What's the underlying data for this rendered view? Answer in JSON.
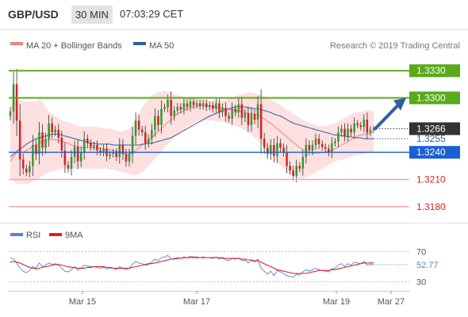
{
  "header": {
    "symbol": "GBP/USD",
    "timeframe": "30 MIN",
    "time": "07:03:29 CET"
  },
  "legend": {
    "ma20_label": "MA 20 + Bollinger Bands",
    "ma50_label": "MA 50",
    "credit": "Research © 2019 Trading Central",
    "ma20_color": "#f08080",
    "ma50_color": "#2e5fa3"
  },
  "rsi_legend": {
    "rsi_label": "RSI",
    "ma9_label": "9MA",
    "rsi_color": "#5b7fd6",
    "ma9_color": "#e02020"
  },
  "colors": {
    "resistance": "#5aaa1c",
    "support": "#1a5fd6",
    "target": "#f4a6a6",
    "current": "#333333",
    "arrow": "#2e5fa3",
    "candle_up": "#2e9a2e",
    "candle_down": "#d62020",
    "band_fill": "#fde0e0"
  },
  "chart_data": [
    {
      "type": "candlestick",
      "title": "GBP/USD",
      "timeframe": "30 MIN",
      "x_ticks": [
        "Mar 15",
        "Mar 17",
        "Mar 19",
        "Mar 27"
      ],
      "ylim": [
        1.3165,
        1.3345
      ],
      "levels": [
        {
          "label": "1.3330",
          "value": 1.333,
          "kind": "resistance"
        },
        {
          "label": "1.3300",
          "value": 1.33,
          "kind": "resistance"
        },
        {
          "label": "1.3266",
          "value": 1.3266,
          "kind": "current"
        },
        {
          "label": "1.3255",
          "value": 1.3255,
          "kind": "ma"
        },
        {
          "label": "1.3240",
          "value": 1.324,
          "kind": "support"
        },
        {
          "label": "1.3210",
          "value": 1.321,
          "kind": "target"
        },
        {
          "label": "1.3180",
          "value": 1.318,
          "kind": "target"
        }
      ],
      "close": [
        1.3285,
        1.3315,
        1.3275,
        1.3232,
        1.3222,
        1.3218,
        1.3225,
        1.3248,
        1.3238,
        1.3262,
        1.3245,
        1.3255,
        1.3272,
        1.3262,
        1.3265,
        1.3256,
        1.3242,
        1.3226,
        1.3222,
        1.3235,
        1.3246,
        1.323,
        1.324,
        1.3255,
        1.325,
        1.3246,
        1.3248,
        1.3242,
        1.324,
        1.3244,
        1.3236,
        1.3238,
        1.324,
        1.3235,
        1.3248,
        1.3238,
        1.323,
        1.3238,
        1.3258,
        1.3275,
        1.3265,
        1.3262,
        1.325,
        1.3255,
        1.3265,
        1.328,
        1.327,
        1.3288,
        1.329,
        1.3298,
        1.328,
        1.3286,
        1.329,
        1.3287,
        1.3294,
        1.329,
        1.3296,
        1.3292,
        1.3294,
        1.3291,
        1.3294,
        1.329,
        1.3292,
        1.3288,
        1.3294,
        1.3284,
        1.3289,
        1.328,
        1.3277,
        1.3288,
        1.3284,
        1.3293,
        1.3278,
        1.3283,
        1.327,
        1.3282,
        1.3276,
        1.3293,
        1.3255,
        1.3245,
        1.3238,
        1.3248,
        1.3236,
        1.325,
        1.3245,
        1.324,
        1.3225,
        1.322,
        1.3214,
        1.3225,
        1.3222,
        1.3235,
        1.3248,
        1.3242,
        1.3248,
        1.3255,
        1.3249,
        1.3246,
        1.3244,
        1.324,
        1.325,
        1.3252,
        1.3262,
        1.3266,
        1.3258,
        1.3266,
        1.3262,
        1.3272,
        1.327,
        1.3268,
        1.3276,
        1.3262,
        1.3265,
        1.3266
      ],
      "ma20": [
        1.323,
        1.3235,
        1.324,
        1.324,
        1.324,
        1.3242,
        1.3244,
        1.3247,
        1.3248,
        1.325,
        1.3252,
        1.3253,
        1.3254,
        1.3254,
        1.3254,
        1.3253,
        1.3252,
        1.3251,
        1.325,
        1.3248,
        1.3247,
        1.3246,
        1.3245,
        1.3245,
        1.3245,
        1.3245,
        1.3245,
        1.3245,
        1.3244,
        1.3244,
        1.3243,
        1.3243,
        1.3242,
        1.3241,
        1.324,
        1.3239,
        1.3238,
        1.3238,
        1.324,
        1.3242,
        1.3245,
        1.3248,
        1.325,
        1.3253,
        1.3256,
        1.326,
        1.3263,
        1.3266,
        1.327,
        1.3273,
        1.3276,
        1.3279,
        1.3282,
        1.3284,
        1.3286,
        1.3288,
        1.3289,
        1.329,
        1.3291,
        1.3291,
        1.3291,
        1.3291,
        1.3291,
        1.329,
        1.329,
        1.3289,
        1.3289,
        1.3288,
        1.3287,
        1.3287,
        1.3286,
        1.3286,
        1.3285,
        1.3284,
        1.3283,
        1.3283,
        1.3282,
        1.3281,
        1.3279,
        1.3277,
        1.3274,
        1.3272,
        1.3269,
        1.3266,
        1.3263,
        1.326,
        1.3257,
        1.3254,
        1.3251,
        1.3248,
        1.3245,
        1.3243,
        1.3241,
        1.324,
        1.3239,
        1.3239,
        1.3239,
        1.324,
        1.324,
        1.3241,
        1.3242,
        1.3244,
        1.3246,
        1.3248,
        1.325,
        1.3252,
        1.3254,
        1.3256,
        1.3258,
        1.3259,
        1.326,
        1.3261,
        1.3261,
        1.3262
      ],
      "bb_upper": [
        1.329,
        1.3298,
        1.33,
        1.3298,
        1.3296,
        1.3296,
        1.3296,
        1.3296,
        1.3296,
        1.3298,
        1.3296,
        1.329,
        1.3285,
        1.3282,
        1.328,
        1.3278,
        1.3275,
        1.3274,
        1.3273,
        1.3272,
        1.327,
        1.3269,
        1.3268,
        1.3268,
        1.3268,
        1.3268,
        1.3268,
        1.3268,
        1.3267,
        1.3267,
        1.3266,
        1.3266,
        1.3265,
        1.3264,
        1.3263,
        1.3263,
        1.3264,
        1.3266,
        1.327,
        1.3276,
        1.3283,
        1.329,
        1.3294,
        1.3298,
        1.3302,
        1.3305,
        1.3306,
        1.3307,
        1.3308,
        1.3307,
        1.3306,
        1.3304,
        1.3303,
        1.3302,
        1.3301,
        1.33,
        1.33,
        1.33,
        1.3299,
        1.3299,
        1.3298,
        1.3298,
        1.3297,
        1.3297,
        1.3297,
        1.3297,
        1.3297,
        1.3298,
        1.3299,
        1.33,
        1.3302,
        1.3303,
        1.3304,
        1.3305,
        1.3306,
        1.3306,
        1.3305,
        1.3304,
        1.3303,
        1.3302,
        1.33,
        1.3298,
        1.3296,
        1.3294,
        1.3292,
        1.329,
        1.3287,
        1.3285,
        1.3282,
        1.328,
        1.3278,
        1.3276,
        1.3274,
        1.3272,
        1.3271,
        1.327,
        1.3269,
        1.3269,
        1.3269,
        1.327,
        1.3271,
        1.3272,
        1.3274,
        1.3276,
        1.3278,
        1.328,
        1.3282,
        1.3283,
        1.3284,
        1.3285,
        1.3285,
        1.3286,
        1.3286,
        1.3286
      ],
      "bb_lower": [
        1.3212,
        1.3208,
        1.3205,
        1.3205,
        1.3205,
        1.3205,
        1.3206,
        1.3208,
        1.321,
        1.3212,
        1.3214,
        1.3216,
        1.3218,
        1.3219,
        1.322,
        1.3221,
        1.3222,
        1.3222,
        1.3222,
        1.3222,
        1.3222,
        1.3222,
        1.3222,
        1.3222,
        1.3222,
        1.3222,
        1.3222,
        1.3222,
        1.3222,
        1.3222,
        1.3222,
        1.3221,
        1.3221,
        1.322,
        1.3219,
        1.3218,
        1.3217,
        1.3216,
        1.3215,
        1.3215,
        1.3216,
        1.3218,
        1.3221,
        1.3225,
        1.3229,
        1.3233,
        1.3237,
        1.3241,
        1.3245,
        1.3249,
        1.3253,
        1.3256,
        1.3259,
        1.3262,
        1.3265,
        1.3268,
        1.327,
        1.3272,
        1.3274,
        1.3275,
        1.3275,
        1.3275,
        1.3275,
        1.3275,
        1.3274,
        1.3274,
        1.3273,
        1.3272,
        1.3271,
        1.327,
        1.3269,
        1.3268,
        1.3266,
        1.3264,
        1.3262,
        1.3259,
        1.3256,
        1.3253,
        1.325,
        1.3246,
        1.3242,
        1.3238,
        1.3234,
        1.323,
        1.3226,
        1.3222,
        1.3219,
        1.3216,
        1.3214,
        1.3212,
        1.3211,
        1.3211,
        1.3212,
        1.3214,
        1.3216,
        1.3218,
        1.322,
        1.3222,
        1.3224,
        1.3226,
        1.3228,
        1.323,
        1.3231,
        1.3232,
        1.3233,
        1.3234,
        1.3235,
        1.3236,
        1.3237,
        1.3238,
        1.3238,
        1.3239,
        1.3239,
        1.324
      ],
      "ma50": [
        1.3235,
        1.3238,
        1.3241,
        1.3244,
        1.3246,
        1.3249,
        1.3251,
        1.3253,
        1.3255,
        1.3256,
        1.3257,
        1.3258,
        1.3259,
        1.326,
        1.326,
        1.326,
        1.3259,
        1.3258,
        1.3257,
        1.3256,
        1.3255,
        1.3254,
        1.3253,
        1.3252,
        1.3251,
        1.325,
        1.325,
        1.3249,
        1.3249,
        1.3249,
        1.3249,
        1.3249,
        1.3248,
        1.3248,
        1.3248,
        1.3248,
        1.3248,
        1.3248,
        1.3248,
        1.3248,
        1.3248,
        1.3249,
        1.3249,
        1.325,
        1.325,
        1.3251,
        1.3252,
        1.3253,
        1.3254,
        1.3255,
        1.3256,
        1.3258,
        1.326,
        1.3262,
        1.3264,
        1.3266,
        1.3268,
        1.327,
        1.3272,
        1.3274,
        1.3276,
        1.3278,
        1.328,
        1.3281,
        1.3283,
        1.3284,
        1.3286,
        1.3287,
        1.3288,
        1.3289,
        1.329,
        1.329,
        1.329,
        1.329,
        1.3289,
        1.3289,
        1.3288,
        1.3288,
        1.3287,
        1.3286,
        1.3285,
        1.3284,
        1.3282,
        1.3281,
        1.328,
        1.3278,
        1.3276,
        1.3274,
        1.3272,
        1.3271,
        1.327,
        1.3269,
        1.3268,
        1.3267,
        1.3266,
        1.3265,
        1.3264,
        1.3263,
        1.3262,
        1.3261,
        1.326,
        1.3259,
        1.3259,
        1.3258,
        1.3258,
        1.3257,
        1.3257,
        1.3256,
        1.3256,
        1.3256,
        1.3255,
        1.3255,
        1.3255,
        1.3255
      ]
    },
    {
      "type": "line",
      "title": "RSI",
      "y_ticks": [
        "70",
        "52.77",
        "30"
      ],
      "ylim": [
        22,
        78
      ],
      "current_value": 52.77,
      "series": [
        {
          "name": "RSI",
          "values": [
            62,
            60,
            55,
            48,
            44,
            42,
            45,
            50,
            48,
            55,
            50,
            52,
            55,
            53,
            54,
            52,
            48,
            44,
            43,
            46,
            50,
            45,
            48,
            52,
            51,
            50,
            50,
            49,
            48,
            49,
            47,
            48,
            48,
            46,
            50,
            48,
            46,
            48,
            53,
            57,
            55,
            54,
            52,
            53,
            56,
            60,
            58,
            62,
            63,
            65,
            60,
            61,
            62,
            61,
            63,
            62,
            64,
            63,
            63,
            62,
            63,
            62,
            62,
            61,
            63,
            60,
            61,
            59,
            58,
            61,
            60,
            62,
            58,
            59,
            55,
            58,
            56,
            60,
            48,
            44,
            40,
            44,
            38,
            45,
            43,
            41,
            38,
            37,
            36,
            40,
            39,
            43,
            46,
            44,
            46,
            48,
            46,
            45,
            44,
            43,
            47,
            48,
            52,
            54,
            50,
            54,
            52,
            56,
            55,
            54,
            57,
            52,
            53,
            52.77
          ]
        },
        {
          "name": "9MA",
          "values": [
            56,
            57,
            56,
            55,
            53,
            51,
            49,
            48,
            47,
            48,
            49,
            50,
            51,
            52,
            53,
            53,
            52,
            51,
            50,
            49,
            49,
            48,
            48,
            48,
            49,
            49,
            50,
            50,
            50,
            50,
            49,
            49,
            48,
            48,
            48,
            48,
            48,
            48,
            49,
            50,
            51,
            52,
            53,
            54,
            54,
            55,
            56,
            57,
            58,
            59,
            60,
            60,
            61,
            61,
            62,
            62,
            62,
            62,
            62,
            62,
            62,
            62,
            62,
            62,
            62,
            62,
            62,
            61,
            61,
            61,
            61,
            61,
            60,
            60,
            59,
            59,
            58,
            58,
            56,
            54,
            52,
            50,
            48,
            46,
            45,
            44,
            43,
            42,
            41,
            41,
            41,
            41,
            41,
            42,
            43,
            44,
            45,
            45,
            45,
            45,
            46,
            46,
            47,
            48,
            49,
            50,
            51,
            52,
            53,
            54,
            55,
            55,
            55,
            55
          ]
        }
      ]
    }
  ]
}
